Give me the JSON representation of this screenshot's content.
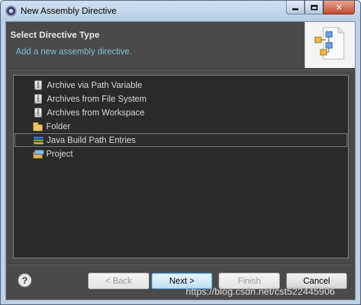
{
  "window": {
    "title": "New Assembly Directive",
    "controls": {
      "minimize_icon": "minimize-icon",
      "maximize_icon": "maximize-icon",
      "close_label": "✕"
    }
  },
  "header": {
    "title": "Select Directive Type",
    "description": "Add a new assembly directive."
  },
  "tree": {
    "items": [
      {
        "label": "Archive via Path Variable",
        "icon": "archive-icon",
        "selected": false
      },
      {
        "label": "Archives from File System",
        "icon": "archive-icon",
        "selected": false
      },
      {
        "label": "Archives from Workspace",
        "icon": "archive-icon",
        "selected": false
      },
      {
        "label": "Folder",
        "icon": "folder-icon",
        "selected": false
      },
      {
        "label": "Java Build Path Entries",
        "icon": "build-path-icon",
        "selected": true
      },
      {
        "label": "Project",
        "icon": "project-folder-icon",
        "selected": false
      }
    ]
  },
  "footer": {
    "help_label": "?",
    "back_label": "< Back",
    "next_label": "Next >",
    "finish_label": "Finish",
    "cancel_label": "Cancel"
  },
  "watermark": "https://blog.csdn.net/cst522445906",
  "colors": {
    "dialog_background": "#4a4a4a",
    "tree_background": "#2a2a2a",
    "description_text": "#7fbfe0",
    "close_button": "#c44c2f"
  }
}
